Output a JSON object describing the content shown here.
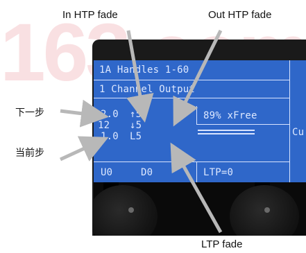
{
  "watermark": "163.com",
  "labels": {
    "in_htp_fade": "In HTP fade",
    "out_htp_fade": "Out HTP fade",
    "ltp_fade": "LTP fade",
    "next_step": "下一步",
    "current_step": "当前步"
  },
  "lcd": {
    "row1": "1A Handles 1-60",
    "row2": "1   Channel Output",
    "next_step_time": "2.0",
    "next_step_fades": "↑5",
    "step_number": "12",
    "out_fade": "↓5",
    "current_step_time": "1.0",
    "ltp_fade": "L5",
    "free": "89% xFree",
    "cue_partial": "Cu",
    "u_counter": "U0",
    "d_counter": "D0",
    "ltp": "LTP=0"
  },
  "colors": {
    "lcd_background": "#2f67c9",
    "lcd_text": "#dde8ff",
    "watermark": "#e05a66",
    "arrow": "#b8b8b8"
  }
}
